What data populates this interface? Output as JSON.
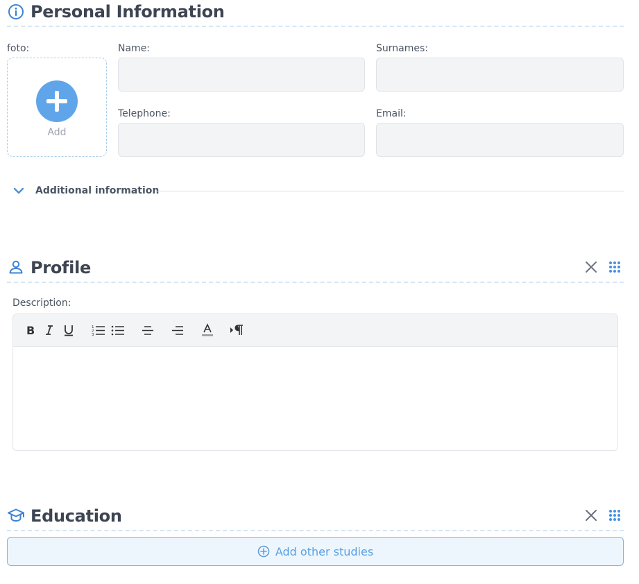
{
  "personal": {
    "title": "Personal Information",
    "photo_label": "foto:",
    "add_label": "Add",
    "name_label": "Name:",
    "surnames_label": "Surnames:",
    "telephone_label": "Telephone:",
    "email_label": "Email:",
    "name_value": "",
    "surnames_value": "",
    "telephone_value": "",
    "email_value": "",
    "additional_label": "Additional information"
  },
  "profile": {
    "title": "Profile",
    "description_label": "Description:",
    "description_value": "",
    "toolbar_icons": [
      "bold-icon",
      "italic-icon",
      "underline-icon",
      "ordered-list-icon",
      "bullet-list-icon",
      "align-center-icon",
      "align-right-icon",
      "text-color-icon",
      "paragraph-direction-icon"
    ]
  },
  "education": {
    "title": "Education",
    "add_button_label": "Add other studies"
  },
  "colors": {
    "accent": "#5aa0e3",
    "heading": "#3d4452",
    "field_bg": "#f3f4f6",
    "dashed_divider": "#d5e6f5"
  }
}
